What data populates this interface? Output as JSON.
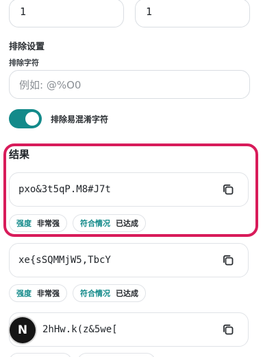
{
  "counts": {
    "left_value": "1",
    "right_value": "1"
  },
  "exclude_settings": {
    "title": "排除设置",
    "chars_label": "排除字符",
    "chars_placeholder": "例如: @%O0",
    "ambiguous_label": "排除易混淆字符",
    "ambiguous_enabled": true
  },
  "results": {
    "title": "结果",
    "strength_key": "强度",
    "match_key": "符合情况",
    "items": [
      {
        "password": "pxo&3t5qP.M8#J7t",
        "strength": "非常强",
        "match": "已达成"
      },
      {
        "password": "xe{sSQMMjW5,TbcY",
        "strength": "非常强",
        "match": "已达成"
      },
      {
        "password": "2hHw.k(z&5we[",
        "strength": "",
        "match": ""
      }
    ]
  },
  "avatar_letter": "N",
  "colors": {
    "accent": "#138a8a",
    "highlight": "#d81b5a"
  },
  "icons": {
    "copy": "copy-icon"
  }
}
